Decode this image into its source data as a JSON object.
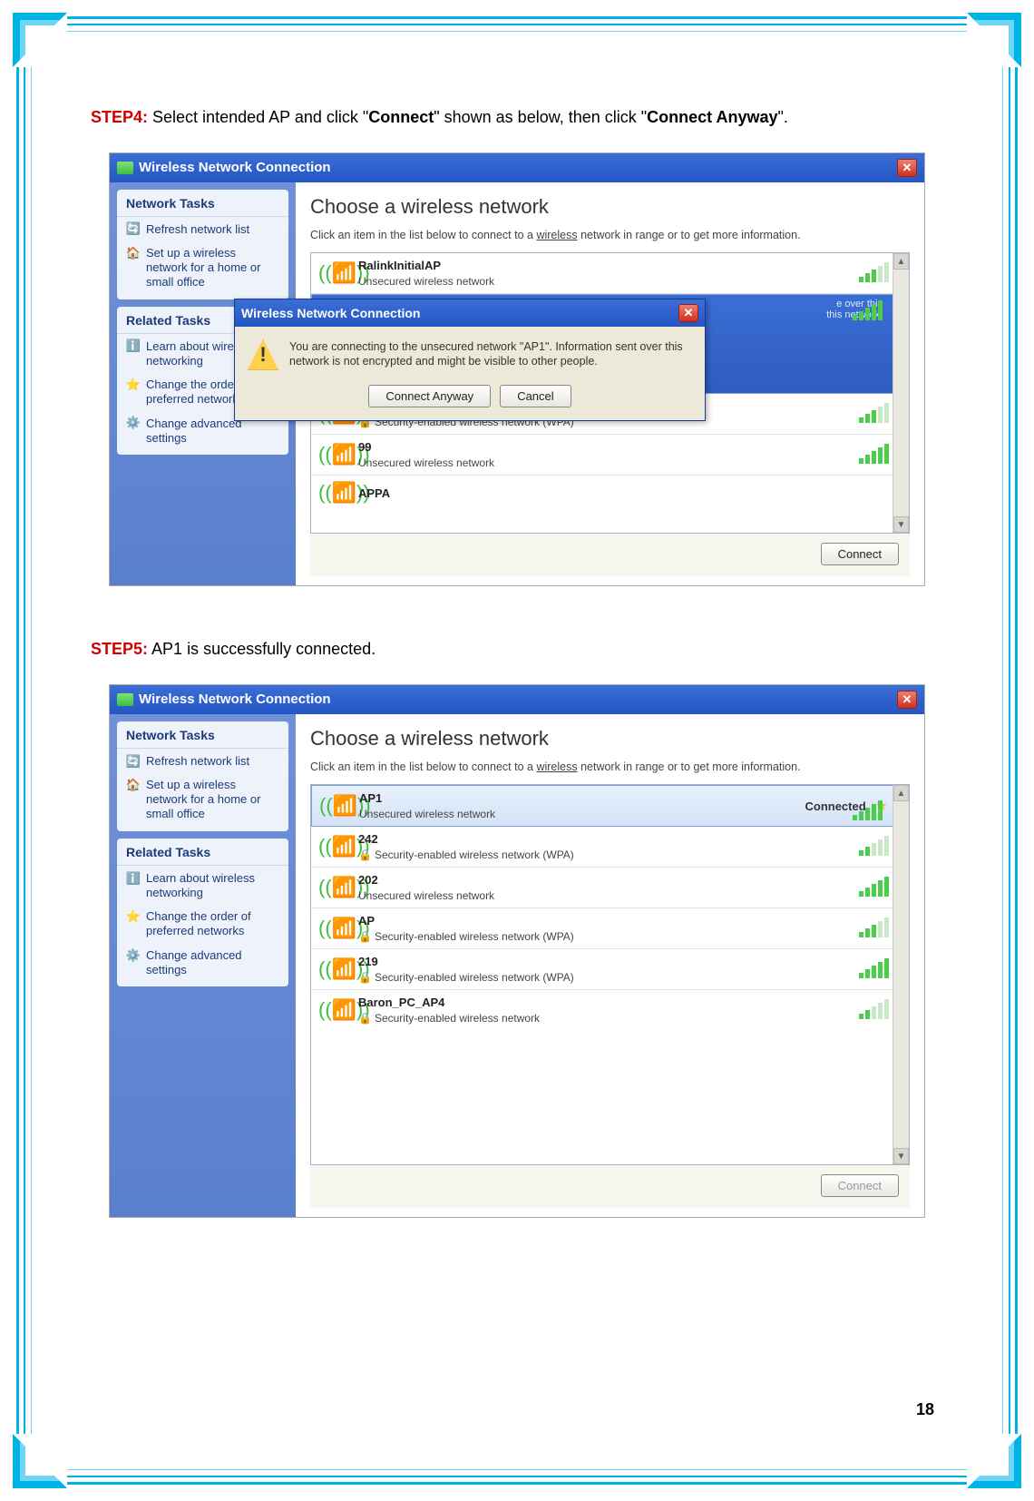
{
  "page_number": "18",
  "step4": {
    "label": "STEP4:",
    "text_a": " Select intended AP and click \"",
    "bold_a": "Connect",
    "text_b": "\" shown as below, then click \"",
    "bold_b": "Connect Anyway",
    "text_c": "\"."
  },
  "step5": {
    "label": "STEP5:",
    "text": " AP1 is successfully connected."
  },
  "shot1": {
    "title": "Wireless Network Connection",
    "sidebar": {
      "tasks_h": "Network Tasks",
      "refresh": "Refresh network list",
      "setup": "Set up a wireless network for a home or small office",
      "related_h": "Related Tasks",
      "learn": "Learn about wireless networking",
      "order": "Change the order of preferred networks",
      "advanced": "Change advanced settings"
    },
    "main": {
      "heading": "Choose a wireless network",
      "sub_a": "Click an item in the list below to connect to a ",
      "sub_u": "wireless",
      "sub_b": " network in range or to get more information.",
      "connect_btn": "Connect"
    },
    "networks": [
      {
        "name": "RalinkInitialAP",
        "sec": "Unsecured wireless network",
        "locked": false
      },
      {
        "name": "",
        "sec": "Security-enabled wireless network (WPA)",
        "locked": true
      },
      {
        "name": "99",
        "sec": "Unsecured wireless network",
        "locked": false
      },
      {
        "name": "APPA",
        "sec": "",
        "locked": false
      }
    ],
    "dialog": {
      "title": "Wireless Network Connection",
      "msg": "You are connecting to the unsecured network \"AP1\". Information sent over this network is not encrypted and might be visible to other people.",
      "btn1": "Connect Anyway",
      "btn2": "Cancel"
    },
    "selected_hint_a": "e over this",
    "selected_hint_b": "this network."
  },
  "shot2": {
    "title": "Wireless Network Connection",
    "sidebar": {
      "tasks_h": "Network Tasks",
      "refresh": "Refresh network list",
      "setup": "Set up a wireless network for a home or small office",
      "related_h": "Related Tasks",
      "learn": "Learn about wireless networking",
      "order": "Change the order of preferred networks",
      "advanced": "Change advanced settings"
    },
    "main": {
      "heading": "Choose a wireless network",
      "sub_a": "Click an item in the list below to connect to a ",
      "sub_u": "wireless",
      "sub_b": " network in range or to get more information.",
      "connect_btn": "Connect",
      "connected_label": "Connected"
    },
    "networks": [
      {
        "name": "AP1",
        "sec": "Unsecured wireless network",
        "locked": false,
        "connected": true
      },
      {
        "name": "242",
        "sec": "Security-enabled wireless network (WPA)",
        "locked": true
      },
      {
        "name": "202",
        "sec": "Unsecured wireless network",
        "locked": false
      },
      {
        "name": "AP",
        "sec": "Security-enabled wireless network (WPA)",
        "locked": true
      },
      {
        "name": "219",
        "sec": "Security-enabled wireless network (WPA)",
        "locked": true
      },
      {
        "name": "Baron_PC_AP4",
        "sec": "Security-enabled wireless network",
        "locked": true
      }
    ]
  }
}
